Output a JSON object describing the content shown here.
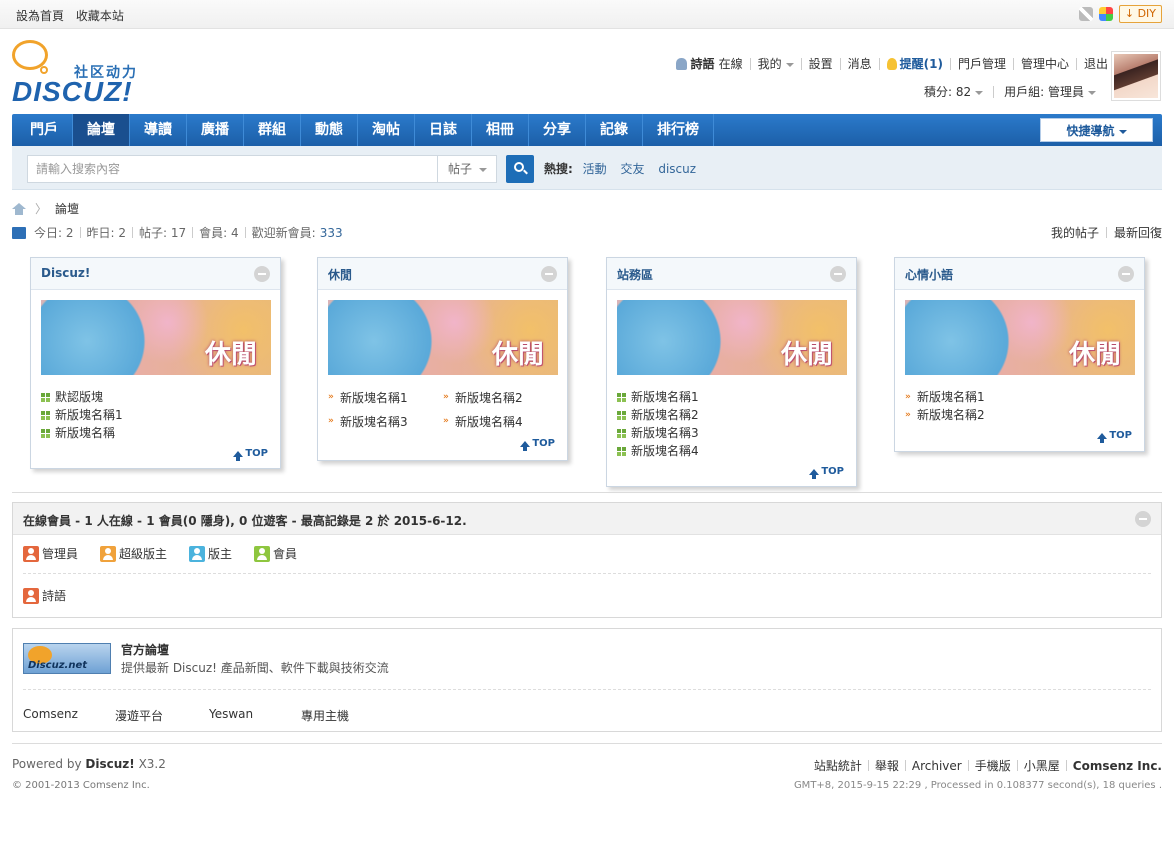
{
  "topbar": {
    "set_home": "設為首頁",
    "bookmark": "收藏本站",
    "diy": "DIY"
  },
  "logo": {
    "subtitle": "社区动力",
    "word": "DISCUZ!"
  },
  "userbar": {
    "username": "詩語",
    "status": "在線",
    "mine": "我的",
    "settings": "設置",
    "messages": "消息",
    "alerts": "提醒(1)",
    "portal_admin": "門戶管理",
    "admin_center": "管理中心",
    "logout": "退出",
    "credits": "積分: 82",
    "usergroup": "用戶組: 管理員"
  },
  "nav": {
    "items": [
      "門戶",
      "論壇",
      "導讀",
      "廣播",
      "群組",
      "動態",
      "淘帖",
      "日誌",
      "相冊",
      "分享",
      "記錄",
      "排行榜"
    ],
    "active": "論壇",
    "quick_nav": "快捷導航"
  },
  "search": {
    "placeholder": "請輸入搜索內容",
    "type": "帖子",
    "hot_label": "熱搜:",
    "hot": [
      "活動",
      "交友",
      "discuz"
    ]
  },
  "breadcrumb": {
    "current": "論壇"
  },
  "stats": {
    "today": "今日: 2",
    "yesterday": "昨日: 2",
    "posts": "帖子: 17",
    "members": "會員: 4",
    "welcome_label": "歡迎新會員:",
    "welcome_user": "333",
    "my_posts": "我的帖子",
    "latest": "最新回復"
  },
  "boards": [
    {
      "title": "Discuz!",
      "banner": "休閒",
      "items": [
        "默認版塊",
        "新版塊名稱1",
        "新版塊名稱"
      ]
    },
    {
      "title": "休閒",
      "banner": "休閒",
      "items": [
        "新版塊名稱1",
        "新版塊名稱2",
        "新版塊名稱3",
        "新版塊名稱4"
      ]
    },
    {
      "title": "站務區",
      "banner": "休閒",
      "items": [
        "新版塊名稱1",
        "新版塊名稱2",
        "新版塊名稱3",
        "新版塊名稱4"
      ]
    },
    {
      "title": "心情小語",
      "banner": "休閒",
      "items": [
        "新版塊名稱1",
        "新版塊名稱2"
      ]
    }
  ],
  "top_label": "TOP",
  "online": {
    "title": "在線會員 - 1 人在線 - 1 會員(0 隱身), 0 位遊客 - 最高記錄是 2 於 2015-6-12.",
    "legend": [
      "管理員",
      "超級版主",
      "版主",
      "會員"
    ],
    "users": [
      "詩語"
    ]
  },
  "links": {
    "logo_text": "Discuz.net",
    "title": "官方論壇",
    "desc": "提供最新 Discuz! 產品新聞、軟件下載與技術交流",
    "items": [
      "Comsenz",
      "漫遊平台",
      "Yeswan",
      "專用主機"
    ]
  },
  "footer": {
    "powered_by": "Powered by",
    "product": "Discuz!",
    "version": "X3.2",
    "copyright": "© 2001-2013 Comsenz Inc.",
    "links": [
      "站點統計",
      "舉報",
      "Archiver",
      "手機版",
      "小黑屋"
    ],
    "company": "Comsenz Inc.",
    "gmt": "GMT+8, 2015-9-15 22:29 , Processed in 0.108377 second(s), 18 queries ."
  },
  "colors": {
    "nav_blue": "#1c5fa8",
    "link_blue": "#336699",
    "accent_orange": "#e67e22"
  }
}
